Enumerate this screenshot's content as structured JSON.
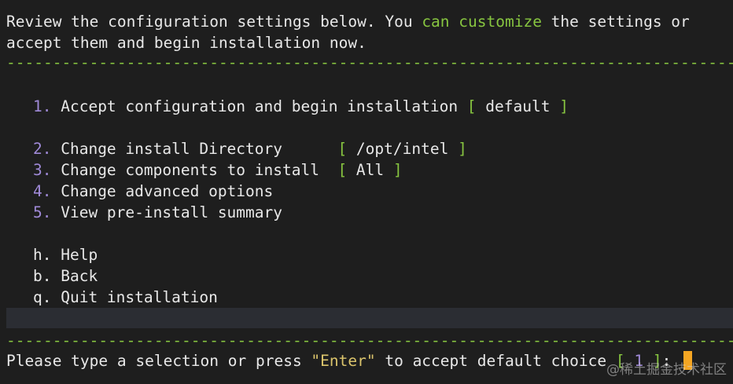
{
  "header": {
    "line1_a": "Review the configuration settings below. You ",
    "line1_b": "can customize",
    "line1_c": " the settings or",
    "line2": "accept them and begin installation now."
  },
  "separator": "------------------------------------------------------------------------------------------------------",
  "menu": {
    "items": [
      {
        "num": "1.",
        "label": "Accept configuration and begin installation ",
        "bracket_open": "[",
        "value": " default ",
        "bracket_close": "]"
      },
      {
        "num": "2.",
        "label": "Change install Directory      ",
        "bracket_open": "[",
        "value": " /opt/intel ",
        "bracket_close": "]"
      },
      {
        "num": "3.",
        "label": "Change components to install  ",
        "bracket_open": "[",
        "value": " All ",
        "bracket_close": "]"
      },
      {
        "num": "4.",
        "label": "Change advanced options"
      },
      {
        "num": "5.",
        "label": "View pre-install summary"
      },
      {
        "num": "h.",
        "label": "Help"
      },
      {
        "num": "b.",
        "label": "Back"
      },
      {
        "num": "q.",
        "label": "Quit installation"
      }
    ]
  },
  "prompt": {
    "text_a": "Please type a selection or press ",
    "enter": "\"Enter\"",
    "text_b": " to accept default choice ",
    "bracket_open": "[",
    "default_num": " 1 ",
    "bracket_close": "]",
    "colon": ": "
  },
  "watermark": "@稀土掘金技术社区"
}
